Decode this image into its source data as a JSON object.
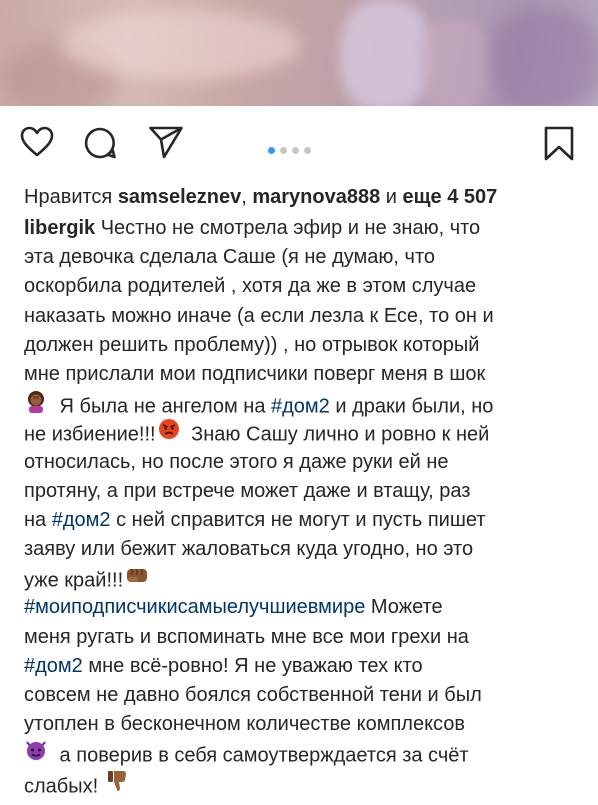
{
  "media": {
    "description_icon": "blurred-photo"
  },
  "actions": {
    "like_icon": "heart-icon",
    "comment_icon": "comment-icon",
    "share_icon": "paper-plane-icon",
    "save_icon": "bookmark-icon",
    "carousel": {
      "count": 4,
      "active_index": 0
    }
  },
  "likes": {
    "prefix": "Нравится ",
    "user1": "samseleznev",
    "sep": ", ",
    "user2": "marynova888",
    "middle": " и ",
    "more": "еще 4 507"
  },
  "caption": {
    "username": "libergik",
    "l1": " Честно не смотрела эфир и не знаю, что",
    "l2": "эта девочка сделала Саше (я не думаю, что",
    "l3": "оскорбила родителей , хотя да же в этом случае",
    "l4": "наказать можно иначе (а если лезла к Есе, то он и",
    "l5": "должен решить проблему)) , но отрывок который",
    "l6": "мне прислали мои подписчики поверг меня в шок",
    "l7a": " Я была не ангелом на ",
    "l7tag": "#дом2",
    "l7b": " и драки были, но",
    "l8a": "не избиение!!!",
    "l8b": " Знаю Сашу лично и ровно к ней",
    "l9": "относилась, но после этого я даже руки ей не",
    "l10": "протяну, а при встрече может даже и втащу, раз",
    "l11a": "на ",
    "l11tag": "#дом2",
    "l11b": " с ней справится не могут и пусть пишет",
    "l12": "заяву или бежит жаловаться куда угодно, но это",
    "l13": "уже край!!!",
    "l14tag": "#моиподписчикисамыелучшиевмире",
    "l14b": " Можете",
    "l15": "меня ругать и вспоминать мне все мои грехи на",
    "l16tag": "#дом2",
    "l16b": " мне всё-ровно! Я не уважаю тех кто",
    "l17": "совсем не давно боялся собственной тени и был",
    "l18": "утоплен в бесконечном количестве комплексов",
    "l19": " а поверив в себя самоутверждается за счёт",
    "l20": "слабых!",
    "emojis": [
      "woman-facepalming-emoji",
      "angry-face-emoji",
      "fist-emoji",
      "devil-emoji",
      "thumbs-down-emoji"
    ]
  },
  "colors": {
    "text": "#262626",
    "hashtag": "#003569",
    "dot_active": "#3897f0",
    "dot_inactive": "#c7c7c7"
  }
}
